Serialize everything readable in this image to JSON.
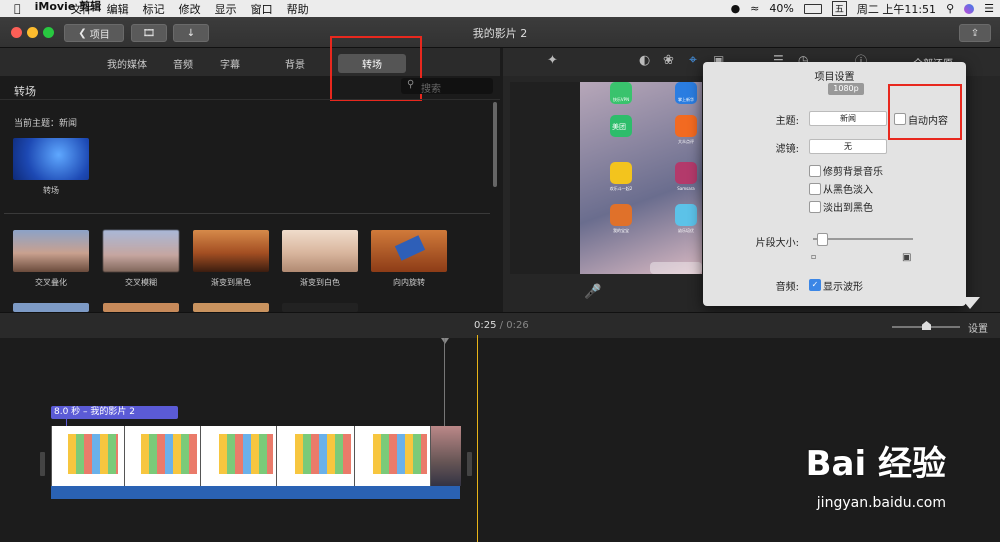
{
  "menubar": {
    "apple": "",
    "items": [
      "iMovie 剪辑",
      "文件",
      "编辑",
      "标记",
      "修改",
      "显示",
      "窗口",
      "帮助"
    ],
    "battery": "40%",
    "input_method": "五",
    "datetime": "周二 上午11:51"
  },
  "titlebar": {
    "back_label": "项目",
    "title": "我的影片 2"
  },
  "tabs": [
    "我的媒体",
    "音频",
    "字幕",
    "背景",
    "转场"
  ],
  "library": {
    "title": "转场",
    "search_placeholder": "搜索",
    "current_theme": "当前主题：新闻",
    "theme_item": "转场",
    "transitions": [
      "交叉叠化",
      "交叉模糊",
      "渐变到黑色",
      "渐变到白色",
      "向内旋转"
    ]
  },
  "viewer": {
    "reset_all": "全部还原",
    "apps": [
      {
        "label": "快乐VPN",
        "color": "#39c36d"
      },
      {
        "label": "掌上新华",
        "color": "#2a7de1"
      },
      {
        "label": "美团",
        "color": "#2dbd6b"
      },
      {
        "label": "大众点评",
        "color": "#f26a21"
      },
      {
        "label": "欢乐斗一起2",
        "color": "#f3c41d"
      },
      {
        "label": "Samsara",
        "color": "#b33a6b"
      },
      {
        "label": "我的宝宝",
        "color": "#e0712a"
      },
      {
        "label": "幼乐培优",
        "color": "#5cc2e8"
      }
    ]
  },
  "settings": {
    "title": "项目设置",
    "resolution": "1080p",
    "theme_label": "主题:",
    "theme_value": "新闻",
    "auto_content": "自动内容",
    "filter_label": "滤镜:",
    "filter_value": "无",
    "trim_music": "修剪背景音乐",
    "fade_in_black": "从黑色淡入",
    "fade_out_black": "淡出到黑色",
    "clip_size_label": "片段大小:",
    "clip_size_level": 0.08,
    "audio_label": "音频:",
    "show_waveforms": "显示波形",
    "show_waveforms_checked": true
  },
  "controlbar": {
    "current": "0:25",
    "separator": "/",
    "total": "0:26",
    "settings_label": "设置"
  },
  "timeline": {
    "clip_label": "8.0 秒 – 我的影片 2"
  },
  "watermark": {
    "brand": "Bai 经验",
    "url": "jingyan.baidu.com"
  },
  "colors": {
    "accent_red": "#e8281e",
    "playhead": "#e8b417",
    "clip_title": "#5b5bd6"
  }
}
